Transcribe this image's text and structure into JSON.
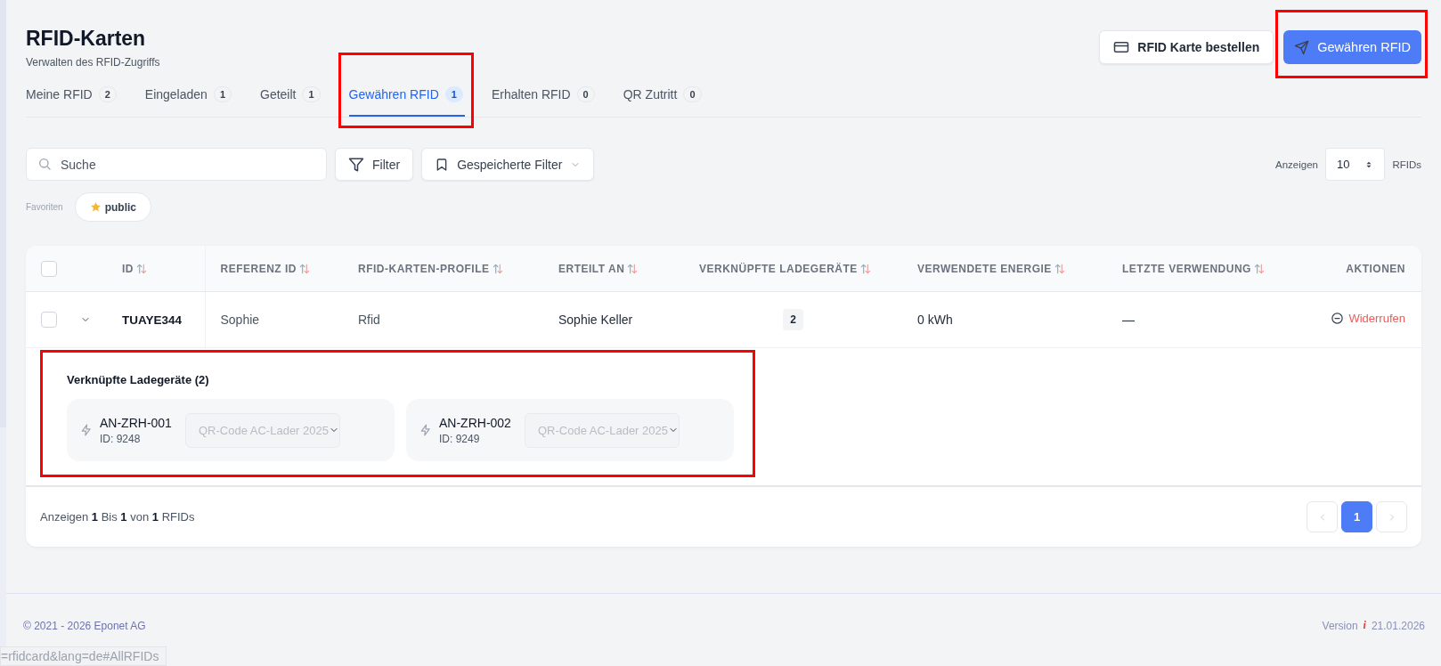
{
  "header": {
    "title": "RFID-Karten",
    "subtitle": "Verwalten des RFID-Zugriffs"
  },
  "actions": [
    {
      "kind": "secondary",
      "label": "RFID Karte bestellen",
      "highlighted": false
    },
    {
      "kind": "primary",
      "label": "Gewähren RFID",
      "highlighted": true
    }
  ],
  "tabs": [
    {
      "label": "Meine RFID",
      "count": "2",
      "selected": false,
      "highlighted": false
    },
    {
      "label": "Eingeladen",
      "count": "1",
      "selected": false,
      "highlighted": false
    },
    {
      "label": "Geteilt",
      "count": "1",
      "selected": false,
      "highlighted": false
    },
    {
      "label": "Gewähren RFID",
      "count": "1",
      "selected": true,
      "highlighted": true
    },
    {
      "label": "Erhalten RFID",
      "count": "0",
      "selected": false,
      "highlighted": false
    },
    {
      "label": "QR Zutritt",
      "count": "0",
      "selected": false,
      "highlighted": false
    }
  ],
  "search": {
    "placeholder": "Suche"
  },
  "filter_button": "Filter",
  "saved_filters": "Gespeicherte Filter",
  "page_size": {
    "label": "Anzeigen",
    "value": "10",
    "unit": "RFIDs"
  },
  "favorites": {
    "label": "Favoriten",
    "items": [
      {
        "label": "public"
      }
    ]
  },
  "table": {
    "select_all_checked": false,
    "columns": [
      {
        "kind": "select"
      },
      {
        "kind": "expand"
      },
      {
        "kind": "text",
        "label": "ID",
        "sortable": true
      },
      {
        "kind": "text",
        "label": "REFERENZ ID",
        "sortable": true
      },
      {
        "kind": "text",
        "label": "RFID-KARTEN-PROFILE",
        "sortable": true
      },
      {
        "kind": "text",
        "label": "ERTEILT AN",
        "sortable": true
      },
      {
        "kind": "text",
        "label": "VERKNÜPFTE LADEGERÄTE",
        "sortable": true
      },
      {
        "kind": "text",
        "label": "VERWENDETE ENERGIE",
        "sortable": true
      },
      {
        "kind": "text",
        "label": "LETZTE VERWENDUNG",
        "sortable": true
      },
      {
        "kind": "actions",
        "label": "AKTIONEN",
        "sortable": false
      }
    ],
    "rows": [
      {
        "checked": false,
        "expanded": true,
        "id": "TUAYE344",
        "reference": "Sophie",
        "profile": "Rfid",
        "granted_to": "Sophie Keller",
        "linked_chargers": "2",
        "energy": "0 kWh",
        "last_used": "—",
        "action": "Widerrufen",
        "details": {
          "title": "Verknüpfte Ladegeräte (2)",
          "highlighted": true,
          "chargers": [
            {
              "name": "AN-ZRH-001",
              "id": "ID: 9248",
              "profile": "QR-Code AC-Lader 2025",
              "disabled": true
            },
            {
              "name": "AN-ZRH-002",
              "id": "ID: 9249",
              "profile": "QR-Code AC-Lader 2025",
              "disabled": true
            }
          ]
        }
      }
    ]
  },
  "pagination": {
    "summary": "Anzeigen **1** Bis **1** von **1** RFIDs",
    "prev_disabled": true,
    "next_disabled": true,
    "pages": [
      {
        "label": "1",
        "selected": true
      }
    ]
  },
  "footer": {
    "copyright": "© 2021 - 2026 Eponet AG",
    "version_label": "Version",
    "version_mark": "i",
    "version": "21.01.2026"
  },
  "status_url": "=rfidcard&lang=de#AllRFIDs"
}
